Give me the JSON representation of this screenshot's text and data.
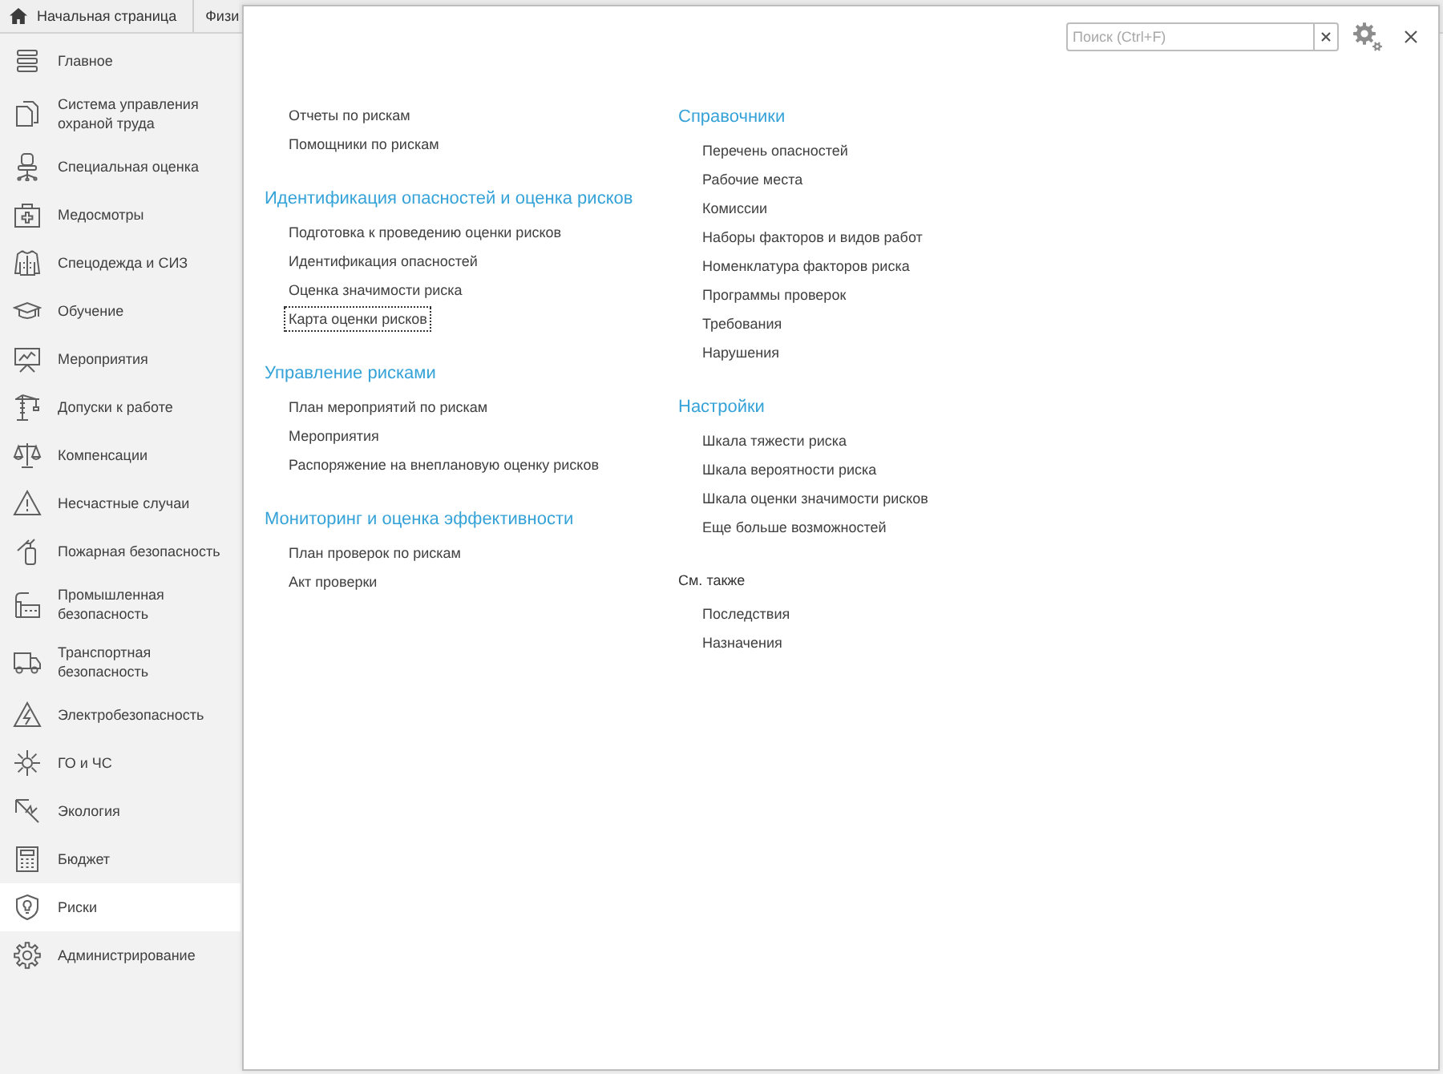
{
  "tabs": [
    {
      "kind": "home",
      "label": "Начальная страница"
    },
    {
      "kind": "page",
      "label": "Физи"
    }
  ],
  "sidebar": {
    "items": [
      {
        "label": "Главное",
        "selected": false
      },
      {
        "label": "Система управления охраной труда",
        "selected": false
      },
      {
        "label": "Специальная оценка",
        "selected": false
      },
      {
        "label": "Медосмотры",
        "selected": false
      },
      {
        "label": "Спецодежда и СИЗ",
        "selected": false
      },
      {
        "label": "Обучение",
        "selected": false
      },
      {
        "label": "Мероприятия",
        "selected": false
      },
      {
        "label": "Допуски к работе",
        "selected": false
      },
      {
        "label": "Компенсации",
        "selected": false
      },
      {
        "label": "Несчастные случаи",
        "selected": false
      },
      {
        "label": "Пожарная безопасность",
        "selected": false
      },
      {
        "label": "Промышленная безопасность",
        "selected": false
      },
      {
        "label": "Транспортная безопасность",
        "selected": false
      },
      {
        "label": "Электробезопасность",
        "selected": false
      },
      {
        "label": "ГО и ЧС",
        "selected": false
      },
      {
        "label": "Экология",
        "selected": false
      },
      {
        "label": "Бюджет",
        "selected": false
      },
      {
        "label": "Риски",
        "selected": true
      },
      {
        "label": "Администрирование",
        "selected": false
      }
    ]
  },
  "panel": {
    "search": {
      "placeholder": "Поиск (Ctrl+F)"
    },
    "columns": [
      {
        "sections": [
          {
            "kind": "group",
            "items": [
              {
                "label": "Отчеты по рискам",
                "focused": false
              },
              {
                "label": "Помощники по рискам",
                "focused": false
              }
            ]
          },
          {
            "kind": "group",
            "title": "Идентификация опасностей и оценка рисков",
            "items": [
              {
                "label": "Подготовка к проведению оценки рисков",
                "focused": false
              },
              {
                "label": "Идентификация опасностей",
                "focused": false
              },
              {
                "label": "Оценка значимости риска",
                "focused": false
              },
              {
                "label": "Карта оценки рисков",
                "focused": true
              }
            ]
          },
          {
            "kind": "group",
            "title": "Управление рисками",
            "items": [
              {
                "label": "План мероприятий по рискам",
                "focused": false
              },
              {
                "label": "Мероприятия",
                "focused": false
              },
              {
                "label": "Распоряжение на внеплановую оценку рисков",
                "focused": false
              }
            ]
          },
          {
            "kind": "group",
            "title": "Мониторинг и оценка эффективности",
            "items": [
              {
                "label": "План проверок по рискам",
                "focused": false
              },
              {
                "label": "Акт проверки",
                "focused": false
              }
            ]
          }
        ]
      },
      {
        "sections": [
          {
            "kind": "group",
            "title": "Справочники",
            "items": [
              {
                "label": "Перечень опасностей",
                "focused": false
              },
              {
                "label": "Рабочие места",
                "focused": false
              },
              {
                "label": "Комиссии",
                "focused": false
              },
              {
                "label": "Наборы факторов и видов работ",
                "focused": false
              },
              {
                "label": "Номенклатура факторов риска",
                "focused": false
              },
              {
                "label": "Программы проверок",
                "focused": false
              },
              {
                "label": "Требования",
                "focused": false
              },
              {
                "label": "Нарушения",
                "focused": false
              }
            ]
          },
          {
            "kind": "group",
            "title": "Настройки",
            "items": [
              {
                "label": "Шкала тяжести риска",
                "focused": false
              },
              {
                "label": "Шкала вероятности риска",
                "focused": false
              },
              {
                "label": "Шкала оценки значимости рисков",
                "focused": false
              },
              {
                "label": "Еще больше возможностей",
                "focused": false
              }
            ]
          },
          {
            "kind": "see_also",
            "title": "См. также",
            "items": [
              {
                "label": "Последствия",
                "focused": false
              },
              {
                "label": "Назначения",
                "focused": false
              }
            ]
          }
        ]
      }
    ]
  }
}
